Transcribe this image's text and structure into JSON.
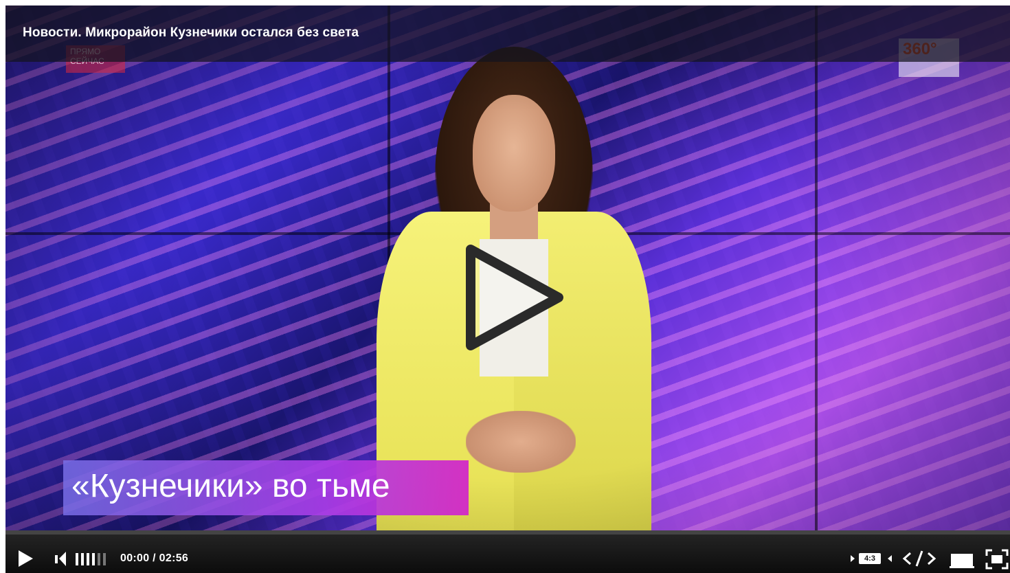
{
  "video": {
    "title": "Новости. Микрорайон Кузнечики остался без света",
    "caption": "«Кузнечики» во тьме",
    "channel_logo_left": "ПРЯМО СЕЙЧАС",
    "channel_logo_right": "360°"
  },
  "controls": {
    "current_time": "00:00",
    "separator": "/",
    "duration": "02:56",
    "aspect_ratio": "4:3",
    "progress": 0
  },
  "colors": {
    "control_bar": "#111111",
    "caption_gradient_start": "#786ee6",
    "caption_gradient_end": "#d228c8",
    "jacket": "#f2ed6e"
  },
  "icons": {
    "play": "play-icon",
    "big_play": "big-play-icon",
    "volume": "volume-icon",
    "aspect": "aspect-ratio-icon",
    "embed": "embed-code-icon",
    "pip": "mini-player-icon",
    "fullscreen": "fullscreen-icon"
  }
}
